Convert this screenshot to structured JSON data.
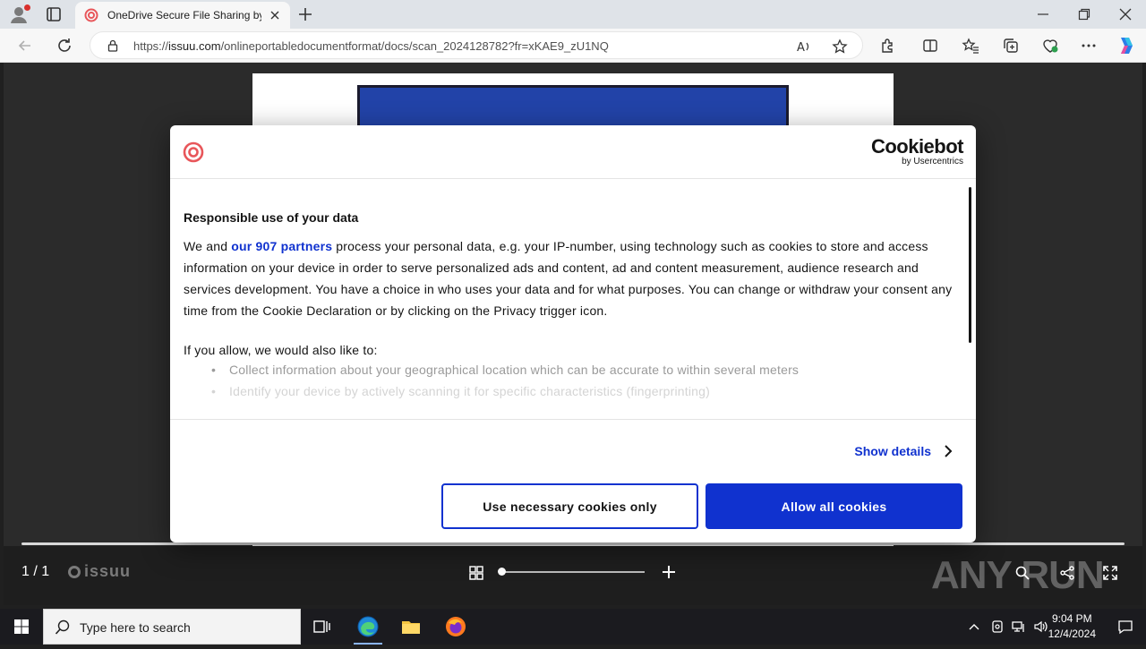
{
  "browser": {
    "tab_title": "OneDrive Secure File Sharing by",
    "url_prefix": "https://",
    "url_domain": "issuu.com",
    "url_path": "/onlineportabledocumentformat/docs/scan_2024128782?fr=xKAE9_zU1NQ"
  },
  "viewer": {
    "page_count": "1 / 1",
    "brand": "issuu",
    "watermark": "ANY RUN"
  },
  "cookie_modal": {
    "brand_name": "Cookiebot",
    "brand_sub": "by Usercentrics",
    "title": "Responsible use of your data",
    "para_before": "We and ",
    "para_link": "our 907 partners",
    "para_after": " process your personal data, e.g. your IP-number, using technology such as cookies to store and access information on your device in order to serve personalized ads and content, ad and content measurement, audience research and services development. You have a choice in who uses your data and for what purposes. You can change or withdraw your consent any time from the Cookie Declaration or by clicking on the Privacy trigger icon.",
    "allow_intro": "If you allow, we would also like to:",
    "bullets": [
      "Collect information about your geographical location which can be accurate to within several meters",
      "Identify your device by actively scanning it for specific characteristics (fingerprinting)"
    ],
    "show_details": "Show details",
    "btn_necessary": "Use necessary cookies only",
    "btn_allow": "Allow all cookies",
    "accent_color": "#1032cf"
  },
  "taskbar": {
    "search_placeholder": "Type here to search",
    "time": "9:04 PM",
    "date": "12/4/2024"
  }
}
